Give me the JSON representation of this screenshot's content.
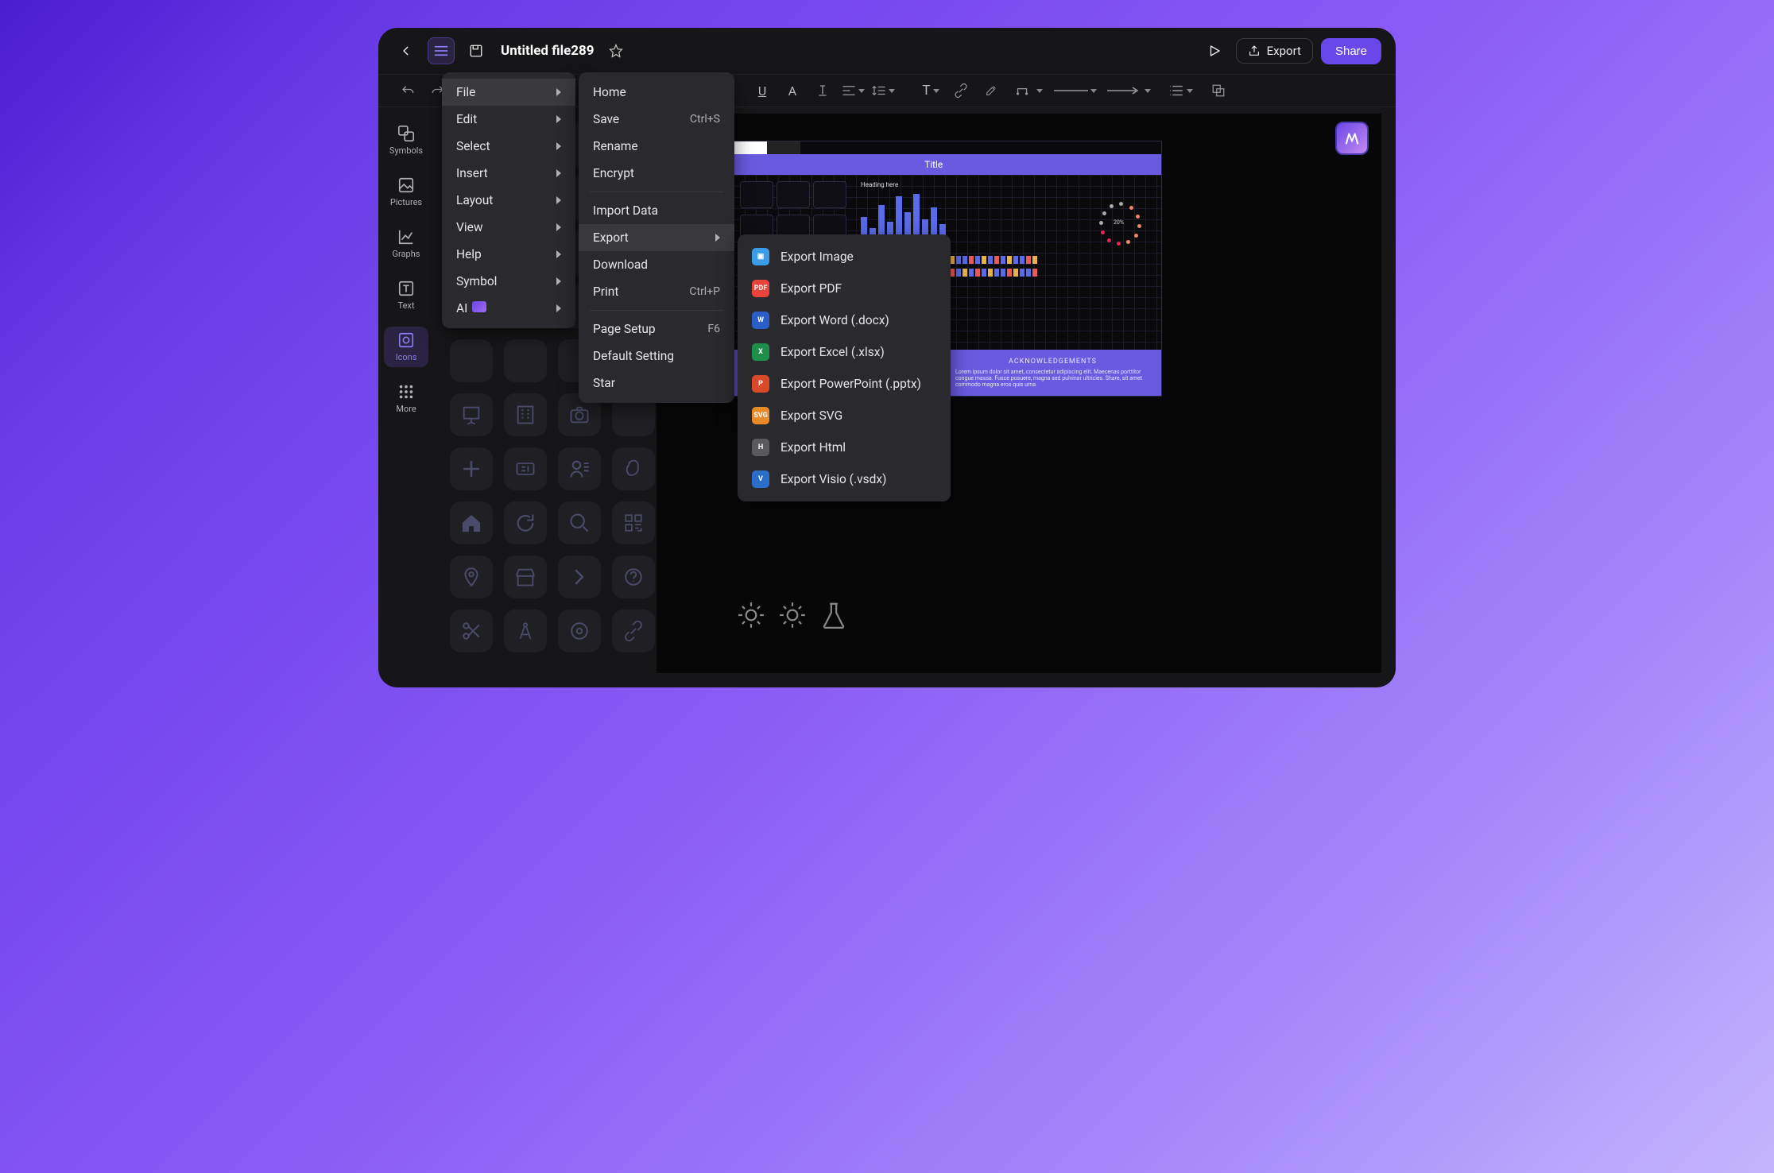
{
  "header": {
    "title": "Untitled file289",
    "export_label": "Export",
    "share_label": "Share"
  },
  "leftnav": {
    "items": [
      {
        "label": "Symbols"
      },
      {
        "label": "Pictures"
      },
      {
        "label": "Graphs"
      },
      {
        "label": "Text"
      },
      {
        "label": "Icons"
      },
      {
        "label": "More"
      }
    ]
  },
  "main_menu": {
    "items": [
      {
        "label": "File"
      },
      {
        "label": "Edit"
      },
      {
        "label": "Select"
      },
      {
        "label": "Insert"
      },
      {
        "label": "Layout"
      },
      {
        "label": "View"
      },
      {
        "label": "Help"
      },
      {
        "label": "Symbol"
      },
      {
        "label": "AI"
      }
    ]
  },
  "file_menu": {
    "items": [
      {
        "label": "Home"
      },
      {
        "label": "Save",
        "shortcut": "Ctrl+S"
      },
      {
        "label": "Rename"
      },
      {
        "label": "Encrypt"
      },
      {
        "label": "Import Data"
      },
      {
        "label": "Export"
      },
      {
        "label": "Download"
      },
      {
        "label": "Print",
        "shortcut": "Ctrl+P"
      },
      {
        "label": "Page Setup",
        "shortcut": "F6"
      },
      {
        "label": "Default Setting"
      },
      {
        "label": "Star"
      }
    ]
  },
  "export_menu": {
    "items": [
      {
        "label": "Export Image"
      },
      {
        "label": "Export PDF"
      },
      {
        "label": "Export Word (.docx)"
      },
      {
        "label": "Export Excel (.xlsx)"
      },
      {
        "label": "Export PowerPoint (.pptx)"
      },
      {
        "label": "Export SVG"
      },
      {
        "label": "Export Html"
      },
      {
        "label": "Export Visio (.vsdx)"
      }
    ]
  },
  "canvas": {
    "title": "Title",
    "heading1": "Heading here",
    "heading2": "Heading here",
    "ack_title": "ACKNOWLEDGEMENTS",
    "ring_center": "20%"
  }
}
